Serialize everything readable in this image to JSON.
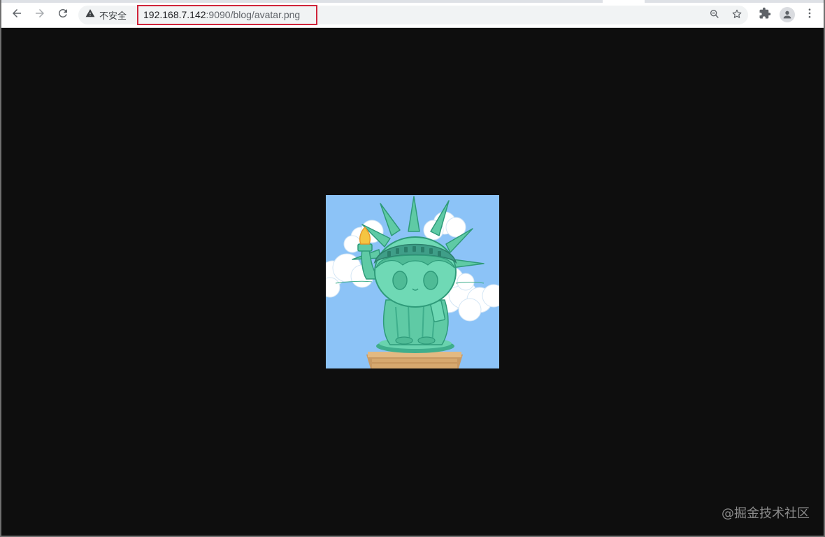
{
  "browser": {
    "security_label": "不安全",
    "url_host": "192.168.7.142",
    "url_rest": ":9090/blog/avatar.png",
    "icons": {
      "back": "arrow-left-icon",
      "forward": "arrow-right-icon",
      "reload": "reload-icon",
      "security": "warning-triangle-icon",
      "zoom": "zoom-out-icon",
      "bookmark": "star-icon",
      "extensions": "puzzle-icon",
      "profile": "person-icon",
      "menu": "kebab-menu-icon"
    },
    "highlight_color": "#d0243a"
  },
  "page": {
    "background": "#0e0e0e",
    "image_description_name": "avatar.png",
    "watermark": "@掘金技术社区"
  }
}
